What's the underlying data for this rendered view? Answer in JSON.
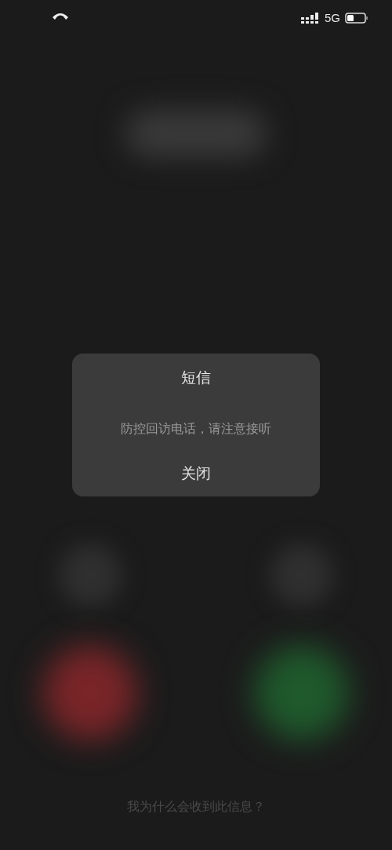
{
  "status_bar": {
    "network": "5G"
  },
  "dialog": {
    "title": "短信",
    "message": "防控回访电话，请注意接听",
    "close_button": "关闭"
  },
  "footer_link": "我为什么会收到此信息？"
}
